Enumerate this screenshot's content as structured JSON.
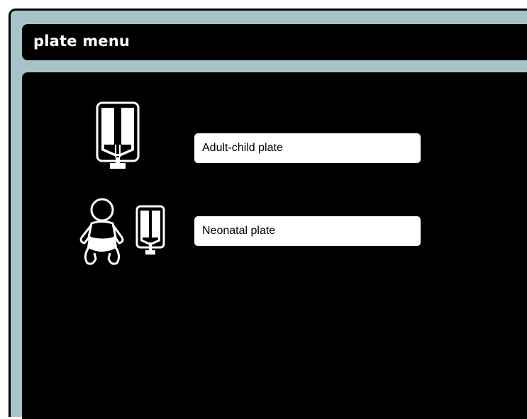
{
  "header": {
    "title": "plate menu"
  },
  "options": [
    {
      "label": "Adult-child plate",
      "icon": "adult-plate-icon"
    },
    {
      "label": "Neonatal plate",
      "icon": "neonatal-plate-icon"
    }
  ],
  "colors": {
    "frame": "#a7c3c8",
    "panel": "#000000",
    "button": "#ffffff",
    "icon": "#ffffff"
  }
}
